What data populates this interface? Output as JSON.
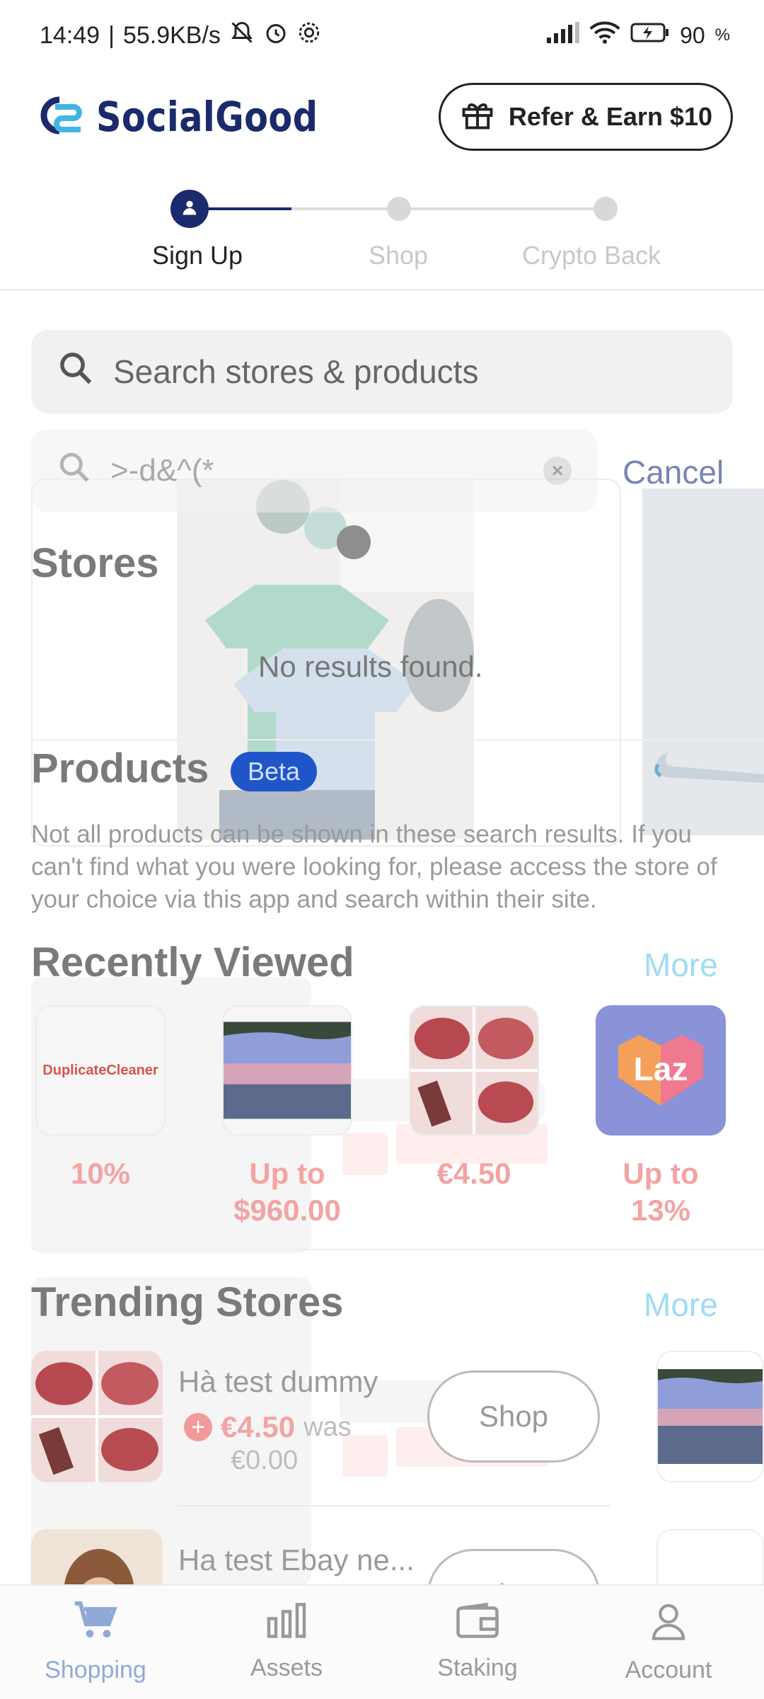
{
  "status_bar": {
    "time": "14:49",
    "network_speed": "55.9KB/s",
    "battery": "90",
    "icons": [
      "muted-bell-icon",
      "alarm-icon",
      "settings-icon",
      "signal-icon",
      "wifi-icon",
      "battery-icon"
    ]
  },
  "header": {
    "brand_name": "SocialGood",
    "refer_button": "Refer & Earn $10"
  },
  "stepper": {
    "steps": [
      {
        "label": "Sign Up",
        "active": true
      },
      {
        "label": "Shop",
        "active": false
      },
      {
        "label": "Crypto Back",
        "active": false
      }
    ]
  },
  "search": {
    "placeholder": "Search stores & products",
    "query": ">-d&^(*",
    "cancel_label": "Cancel"
  },
  "stores": {
    "title": "Stores",
    "empty_message": "No results found."
  },
  "products": {
    "title": "Products",
    "badge": "Beta",
    "disclaimer": "Not all products can be shown in these search results. If you can't find what you were looking for, please access the store of your choice via this app and search within their site."
  },
  "recently_viewed": {
    "title": "Recently Viewed",
    "more_label": "More",
    "items": [
      {
        "thumb": "DuplicateCleaner",
        "value": "10%"
      },
      {
        "thumb": "lake-sunset",
        "value": "Up to $960.00"
      },
      {
        "thumb": "lipstick",
        "value": "€4.50"
      },
      {
        "thumb": "Laz",
        "value": "Up to 13%"
      }
    ]
  },
  "trending_stores": {
    "title": "Trending Stores",
    "more_label": "More",
    "rows": [
      {
        "name": "Hà test dummy",
        "price": "€4.50",
        "was_label": "was",
        "was_price": "€0.00",
        "shop_label": "Shop"
      },
      {
        "name": "Ha test Ebay ne...",
        "shop_label": "Shop"
      }
    ]
  },
  "bottom_nav": {
    "items": [
      {
        "label": "Shopping",
        "active": true
      },
      {
        "label": "Assets",
        "active": false
      },
      {
        "label": "Staking",
        "active": false
      },
      {
        "label": "Account",
        "active": false
      }
    ]
  },
  "colors": {
    "brand_navy": "#1a2a6c",
    "more_link": "#9fdcf4",
    "price_pink": "#f2a4a4",
    "beta_blue": "#1f55c8",
    "nav_active": "#8faad8"
  }
}
